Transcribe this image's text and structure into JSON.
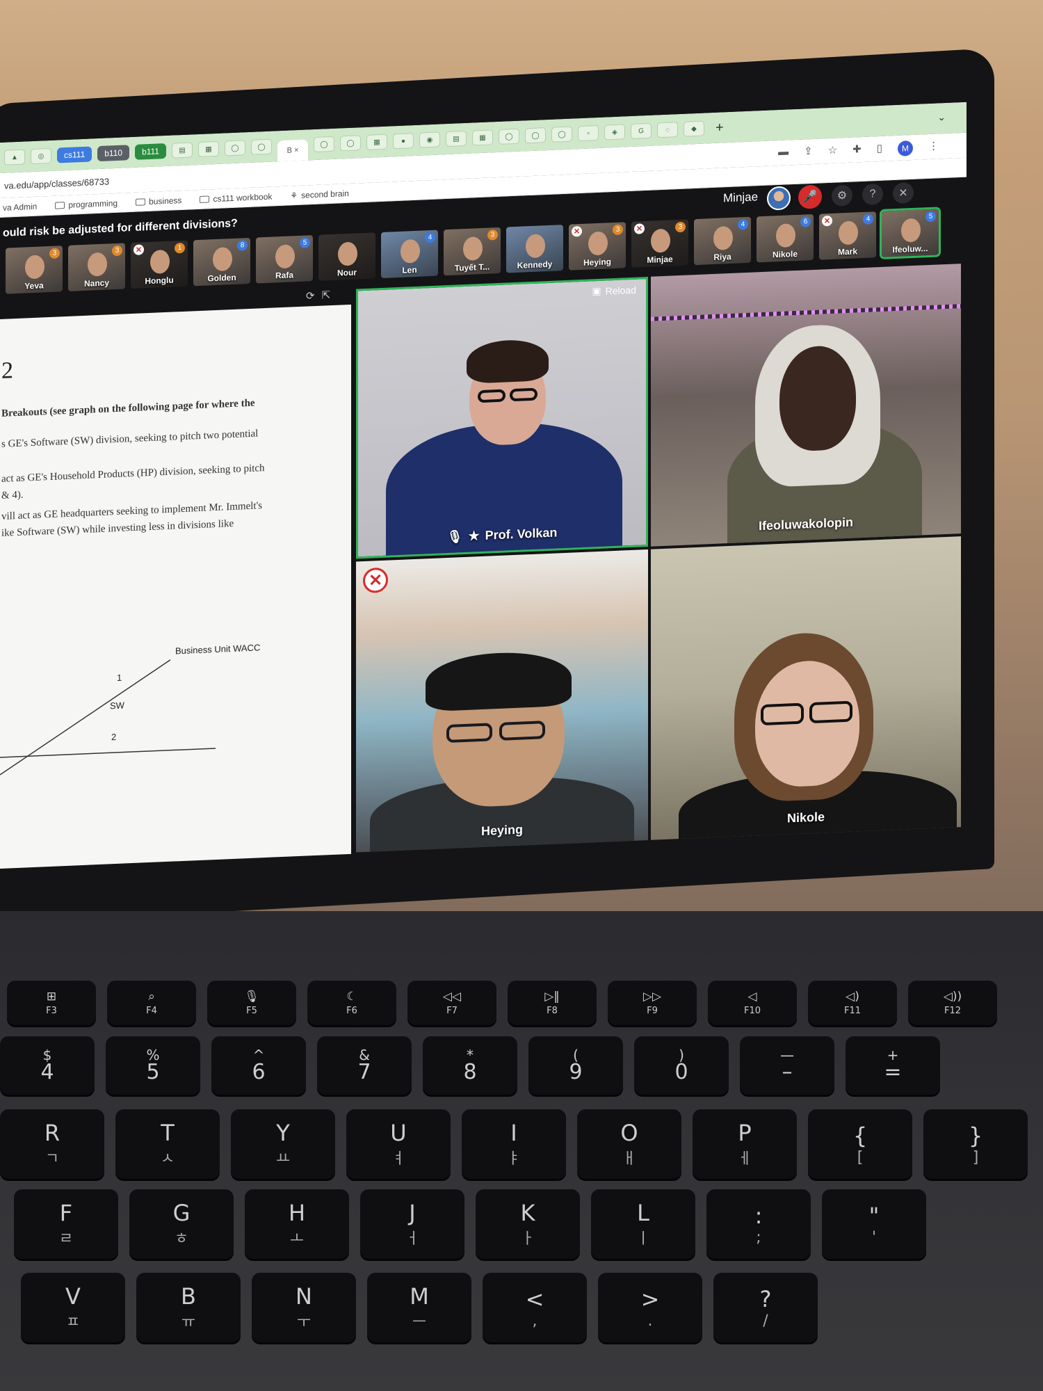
{
  "browser": {
    "tabs": {
      "chip_cs111": "cs111",
      "chip_b110": "b110",
      "chip_b111": "b111",
      "active_tab_text": "B ×",
      "new_tab": "+",
      "tab_list": "⌄"
    },
    "url": "va.edu/app/classes/68733",
    "profile_initial": "M",
    "bookmarks": {
      "item1": "va Admin",
      "item2": "programming",
      "item3": "business",
      "item4": "cs111 workbook",
      "item5": "second brain"
    }
  },
  "meeting": {
    "question": "ould risk be adjusted for different divisions?",
    "user_name": "Minjae",
    "controls": {
      "settings_icon": "gear-icon",
      "help": "?",
      "close": "✕"
    },
    "thumbnails": [
      {
        "name": "Yeva",
        "badge": "3"
      },
      {
        "name": "Nancy",
        "badge": "3"
      },
      {
        "name": "Honglu",
        "badge": "1"
      },
      {
        "name": "Golden",
        "badge": "8"
      },
      {
        "name": "Rafa",
        "badge": "5"
      },
      {
        "name": "Nour",
        "badge": ""
      },
      {
        "name": "Len",
        "badge": "4"
      },
      {
        "name": "Tuyết T...",
        "badge": "3"
      },
      {
        "name": "Kennedy",
        "badge": ""
      },
      {
        "name": "Heying",
        "badge": "3"
      },
      {
        "name": "Minjae",
        "badge": "3"
      },
      {
        "name": "Riya",
        "badge": "4"
      },
      {
        "name": "Nikole",
        "badge": "6"
      },
      {
        "name": "Mark",
        "badge": "4"
      },
      {
        "name": "Ifeoluw...",
        "badge": "5"
      }
    ],
    "document": {
      "number": "2",
      "line1": "Breakouts (see graph on the following page for where the",
      "line2": "s GE's Software (SW) division, seeking to pitch two potential",
      "line3": "act as GE's Household Products (HP) division, seeking to pitch",
      "line4": "& 4).",
      "line5": "vill act as GE headquarters seeking to implement Mr. Immelt's",
      "line6": "ike Software (SW) while investing less in divisions like",
      "graph_title": "Business Unit WACC",
      "graph_label_1": "1",
      "graph_label_sw": "SW",
      "graph_label_2": "2"
    },
    "tiles": {
      "reload_label": "Reload",
      "presenter": "Prof. Volkan",
      "tile2": "Ifeoluwakolopin",
      "tile3": "Heying",
      "tile4": "Nikole"
    }
  },
  "keyboard": {
    "fkeys": [
      {
        "icon": "⊞",
        "label": "F3"
      },
      {
        "icon": "⌕",
        "label": "F4"
      },
      {
        "icon": "🎙",
        "label": "F5"
      },
      {
        "icon": "☾",
        "label": "F6"
      },
      {
        "icon": "◁◁",
        "label": "F7"
      },
      {
        "icon": "▷‖",
        "label": "F8"
      },
      {
        "icon": "▷▷",
        "label": "F9"
      },
      {
        "icon": "◁",
        "label": "F10"
      },
      {
        "icon": "◁)",
        "label": "F11"
      },
      {
        "icon": "◁))",
        "label": "F12"
      }
    ],
    "numkeys": [
      {
        "top": "$",
        "main": "4"
      },
      {
        "top": "%",
        "main": "5"
      },
      {
        "top": "^",
        "main": "6"
      },
      {
        "top": "&",
        "main": "7"
      },
      {
        "top": "*",
        "main": "8"
      },
      {
        "top": "(",
        "main": "9"
      },
      {
        "top": ")",
        "main": "0"
      },
      {
        "top": "—",
        "main": "–"
      },
      {
        "top": "+",
        "main": "="
      }
    ],
    "row_q": [
      {
        "main": "R",
        "sub": "ㄱ"
      },
      {
        "main": "T",
        "sub": "ㅅ"
      },
      {
        "main": "Y",
        "sub": "ㅛ"
      },
      {
        "main": "U",
        "sub": "ㅕ"
      },
      {
        "main": "I",
        "sub": "ㅑ"
      },
      {
        "main": "O",
        "sub": "ㅐ"
      },
      {
        "main": "P",
        "sub": "ㅔ"
      },
      {
        "main": "{",
        "sub": "["
      },
      {
        "main": "}",
        "sub": "]"
      }
    ],
    "row_a": [
      {
        "main": "F",
        "sub": "ㄹ"
      },
      {
        "main": "G",
        "sub": "ㅎ"
      },
      {
        "main": "H",
        "sub": "ㅗ"
      },
      {
        "main": "J",
        "sub": "ㅓ"
      },
      {
        "main": "K",
        "sub": "ㅏ"
      },
      {
        "main": "L",
        "sub": "ㅣ"
      },
      {
        "main": ":",
        "sub": ";"
      },
      {
        "main": "\"",
        "sub": "'"
      }
    ],
    "row_z": [
      {
        "main": "V",
        "sub": "ㅍ"
      },
      {
        "main": "B",
        "sub": "ㅠ"
      },
      {
        "main": "N",
        "sub": "ㅜ"
      },
      {
        "main": "M",
        "sub": "ㅡ"
      },
      {
        "main": "<",
        "sub": ","
      },
      {
        "main": ">",
        "sub": "."
      },
      {
        "main": "?",
        "sub": "/"
      }
    ]
  }
}
